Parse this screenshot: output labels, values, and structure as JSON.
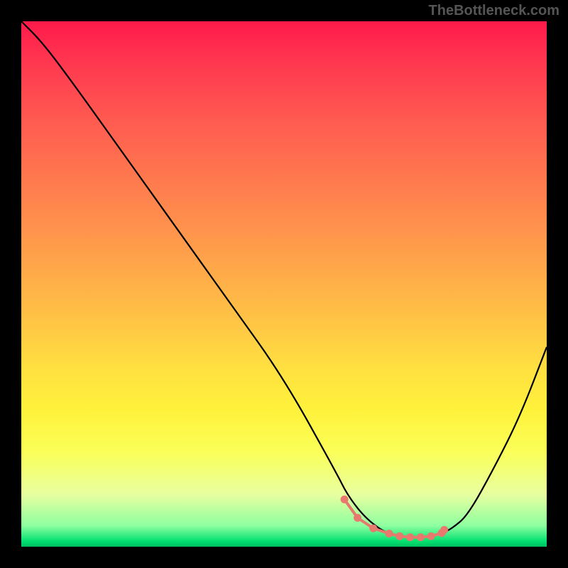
{
  "watermark": "TheBottleneck.com",
  "chart_data": {
    "type": "line",
    "title": "",
    "xlabel": "",
    "ylabel": "",
    "xlim": [
      0,
      100
    ],
    "ylim": [
      0,
      100
    ],
    "series": [
      {
        "name": "bottleneck-curve",
        "x": [
          0,
          4,
          10,
          20,
          30,
          40,
          50,
          60,
          62,
          65,
          68,
          70,
          72,
          74,
          76,
          78,
          80,
          82,
          85,
          90,
          95,
          100
        ],
        "y": [
          100,
          96,
          88,
          74,
          60,
          46,
          32,
          14,
          10,
          6,
          3.5,
          2.5,
          2,
          1.8,
          1.8,
          2,
          2.5,
          3.5,
          6,
          15,
          25,
          38
        ]
      }
    ],
    "markers": {
      "name": "highlight-points",
      "color": "#e8796e",
      "x": [
        61.5,
        64,
        67,
        70,
        72,
        74,
        76,
        78,
        80,
        80.5
      ],
      "y": [
        9,
        5.5,
        3.5,
        2.5,
        2,
        1.8,
        1.8,
        2,
        2.6,
        3.2
      ]
    },
    "gradient_stops": [
      {
        "pos": 0,
        "color": "#ff1a4a"
      },
      {
        "pos": 8,
        "color": "#ff3850"
      },
      {
        "pos": 20,
        "color": "#ff5e50"
      },
      {
        "pos": 32,
        "color": "#ff7e4e"
      },
      {
        "pos": 45,
        "color": "#ffa24a"
      },
      {
        "pos": 57,
        "color": "#ffc445"
      },
      {
        "pos": 66,
        "color": "#ffe040"
      },
      {
        "pos": 74,
        "color": "#fff23b"
      },
      {
        "pos": 82,
        "color": "#faff58"
      },
      {
        "pos": 90,
        "color": "#e8ffa0"
      },
      {
        "pos": 96,
        "color": "#8effa0"
      },
      {
        "pos": 99,
        "color": "#00e070"
      },
      {
        "pos": 100,
        "color": "#00c060"
      }
    ]
  }
}
